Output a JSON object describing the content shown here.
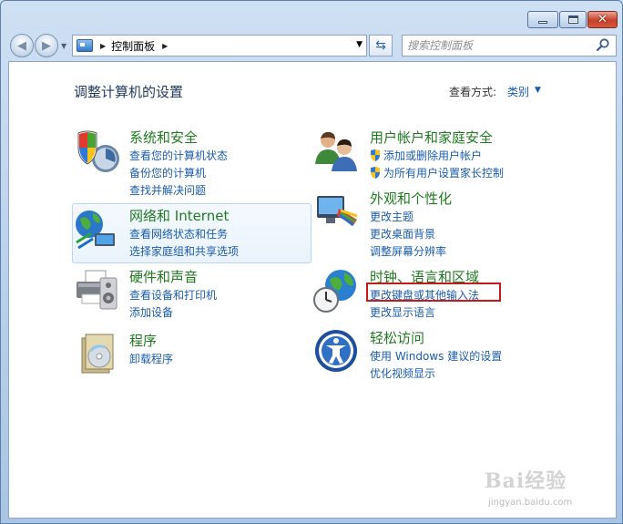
{
  "address": {
    "breadcrumb": "控制面板"
  },
  "search": {
    "placeholder": "搜索控制面板"
  },
  "main": {
    "title": "调整计算机的设置",
    "view_by_label": "查看方式:",
    "view_by_value": "类别"
  },
  "categories": {
    "security": {
      "title": "系统和安全",
      "links": [
        "查看您的计算机状态",
        "备份您的计算机",
        "查找并解决问题"
      ]
    },
    "network": {
      "title": "网络和 Internet",
      "links": [
        "查看网络状态和任务",
        "选择家庭组和共享选项"
      ]
    },
    "hardware": {
      "title": "硬件和声音",
      "links": [
        "查看设备和打印机",
        "添加设备"
      ]
    },
    "programs": {
      "title": "程序",
      "links": [
        "卸载程序"
      ]
    },
    "users": {
      "title": "用户帐户和家庭安全",
      "links": [
        "添加或删除用户帐户",
        "为所有用户设置家长控制"
      ]
    },
    "appearance": {
      "title": "外观和个性化",
      "links": [
        "更改主题",
        "更改桌面背景",
        "调整屏幕分辨率"
      ]
    },
    "clock": {
      "title": "时钟、语言和区域",
      "links": [
        "更改键盘或其他输入法",
        "更改显示语言"
      ]
    },
    "ease": {
      "title": "轻松访问",
      "links": [
        "使用 Windows 建议的设置",
        "优化视频显示"
      ]
    }
  },
  "watermark": {
    "brand": "Bai经验",
    "url": "jingyan.baidu.com"
  },
  "colors": {
    "category_title": "#207a20",
    "link": "#1a5cad",
    "highlight_box": "#c41a1a"
  }
}
